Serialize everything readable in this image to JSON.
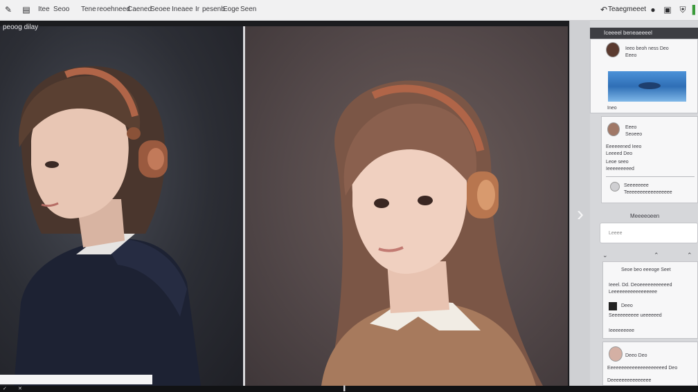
{
  "toolbar": {
    "menu_items": [
      "Itee",
      "Seoo",
      "Tene",
      "reoehneed",
      "Caened",
      "Seoee",
      "Ineaee",
      "Ir",
      "pesenb",
      "Eoge",
      "Seen"
    ],
    "right_label": "Teaegmeeet"
  },
  "canvas": {
    "title": "peoog dilay"
  },
  "panel": {
    "header": "Iceeeel beneaeeeel",
    "card1": {
      "line1": "Ieeo beoh ness Deo",
      "line2": "Eeeo",
      "caption": "Ineo"
    },
    "card2": {
      "line1": "Eeeo",
      "line2": "Seoeeo",
      "line3": "Eeeeeened Ieeo",
      "line4": "Leeeed Deo",
      "line5": "Leoe seeo",
      "line6": "Ieeeeeeeeed"
    },
    "card3": {
      "line1": "Seeeeeeee",
      "line2": "Teeeeeeeeeeeeeeeee"
    },
    "section_title": "Meeeeoeen",
    "search_placeholder": "Leeee",
    "list": {
      "title": "Seoe beo eeeoge Seet",
      "row1": "Ieeel. Dd. Deoeeeeeeeeeeed",
      "row2": "Leeeeeeeeeeeeeeeee",
      "row3": "Deeo",
      "row4": "Seeeeeeeeee ueeeeeed",
      "row5": "Ieeeeeeeee"
    },
    "card4": {
      "line1": "Deeo Deo",
      "line2": "Eeeeeeeeeeeeeeeeeeeeed Deo",
      "line3": "Deeeeeeeeeeeeeee"
    }
  },
  "colors": {
    "left_background": "#2c2e35",
    "right_background": "#54494a",
    "sweater_left": "#1d2233",
    "sweater_right": "#a77a5d",
    "headphone_accent": "#b06548"
  },
  "icons": [
    "pen-icon",
    "layers-icon",
    "undo-icon",
    "settings-icon",
    "save-icon",
    "shield-icon",
    "chevron-right-icon"
  ]
}
